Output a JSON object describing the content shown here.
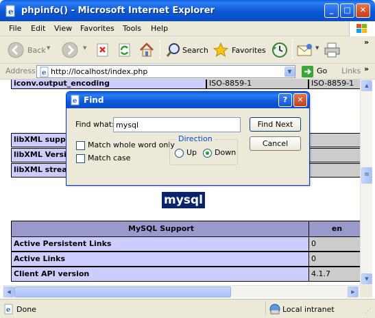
{
  "window": {
    "title": "phpinfo() - Microsoft Internet Explorer"
  },
  "menu": [
    "File",
    "Edit",
    "View",
    "Favorites",
    "Tools",
    "Help"
  ],
  "toolbar": {
    "back": "Back",
    "search": "Search",
    "favorites": "Favorites"
  },
  "address": {
    "label": "Address",
    "url": "http://localhost/index.php",
    "go": "Go",
    "links": "Links"
  },
  "page": {
    "iconv_row": [
      "iconv.output_encoding",
      "ISO-8859-1",
      "ISO-8859-1"
    ],
    "libxml_rows": [
      "libXML suppo",
      "libXML Versio",
      "libXML stream"
    ],
    "section_title": "mysql",
    "mysql_header": [
      "MySQL Support",
      "en"
    ],
    "mysql_rows": [
      [
        "Active Persistent Links",
        "0"
      ],
      [
        "Active Links",
        "0"
      ],
      [
        "Client API version",
        "4.1.7"
      ]
    ]
  },
  "find_dialog": {
    "title": "Find",
    "find_what_label": "Find what:",
    "find_what_value": "mysql",
    "match_whole_word": "Match whole word only",
    "match_case": "Match case",
    "direction_label": "Direction",
    "up": "Up",
    "down": "Down",
    "direction_selected": "Down",
    "find_next": "Find Next",
    "cancel": "Cancel",
    "help_glyph": "?",
    "close_glyph": "✕"
  },
  "status": {
    "text": "Done",
    "zone": "Local intranet"
  },
  "colors": {
    "xp_blue": "#0a4ec8",
    "php_header": "#9999cc",
    "php_key": "#ccccff",
    "php_value": "#cccccc"
  }
}
